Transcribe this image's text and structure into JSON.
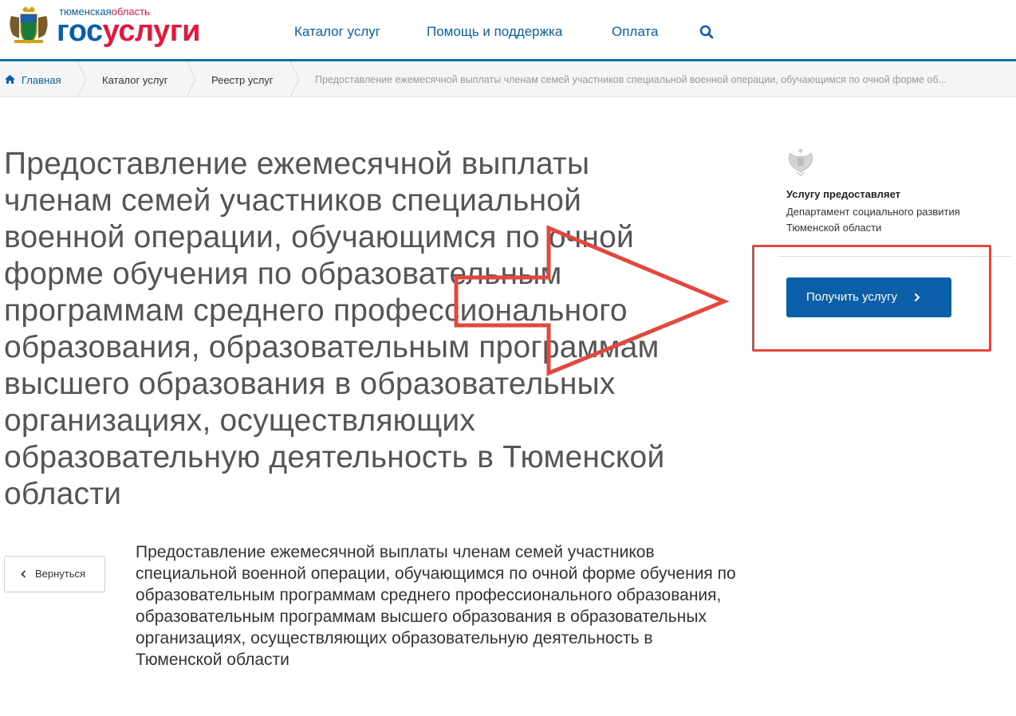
{
  "header": {
    "logo_region_part1": "тюменская",
    "logo_region_part2": "область",
    "logo_word_part1": "гос",
    "logo_word_part2": "услуги",
    "nav": [
      {
        "label": "Каталог услуг"
      },
      {
        "label": "Помощь и поддержка"
      },
      {
        "label": "Оплата"
      }
    ],
    "search_icon": "search-icon"
  },
  "breadcrumb": {
    "home": "Главная",
    "items": [
      {
        "label": "Каталог услуг"
      },
      {
        "label": "Реестр услуг"
      },
      {
        "label": "Предоставление ежемесячной выплаты членам семей участников специальной военной операции, обучающимся по очной форме об..."
      }
    ]
  },
  "main": {
    "title": "Предоставление ежемесячной выплаты членам семей участников специальной военной операции, обучающимся по очной форме обучения по образовательным программам среднего профессионального образования, образовательным программам высшего образования в образовательных организациях, осуществляющих образовательную деятельность в Тюменской области",
    "description": "Предоставление ежемесячной выплаты членам семей участников специальной военной операции, обучающимся по очной форме обучения по образовательным программам среднего профессионального образования, образовательным программам высшего образования в образовательных организациях, осуществляющих образовательную деятельность в Тюменской области",
    "back_label": "Вернуться"
  },
  "provider": {
    "label": "Услугу предоставляет",
    "name": "Департамент социального развития Тюменской области",
    "button_label": "Получить услугу"
  },
  "colors": {
    "brand_blue": "#0b5ea8",
    "brand_red": "#e5183b",
    "annotation_red": "#e2483f"
  }
}
